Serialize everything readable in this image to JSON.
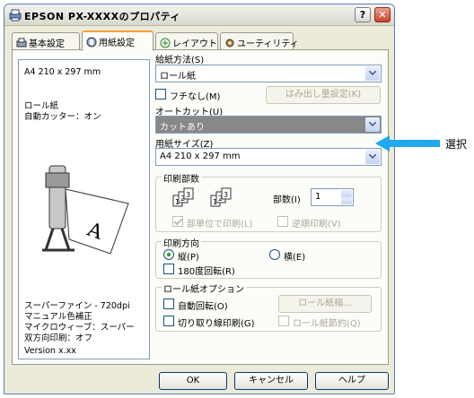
{
  "window": {
    "title": "EPSON PX-XXXXのプロパティ",
    "help_btn": "?",
    "close_btn": "✕"
  },
  "tabs": [
    "基本設定",
    "用紙設定",
    "レイアウト",
    "ユーティリティ"
  ],
  "preview": {
    "paper": "A4 210 x 297 mm",
    "source": "ロール紙",
    "autocut": "自動カッター：オン",
    "quality": "スーパーファイン - 720dpi",
    "color": "マニュアル色補正",
    "weave": "マイクロウィーブ：スーパー",
    "bidir": "双方向印刷：オフ",
    "version": "Version x.xx"
  },
  "paper_source": {
    "label": "給紙方法(S)",
    "value": "ロール紙"
  },
  "borderless": {
    "label": "フチなし(M)",
    "checked": false
  },
  "overflow_button": "はみ出し量設定(K)",
  "autocut": {
    "label": "オートカット(U)",
    "value": "カットあり"
  },
  "paper_size": {
    "label": "用紙サイズ(Z)",
    "value": "A4 210 x 297 mm"
  },
  "copies_group": {
    "title": "印刷部数",
    "copies_label": "部数(I)",
    "copies_value": "1",
    "collate_label": "部単位で印刷(L)",
    "reverse_label": "逆順印刷(V)"
  },
  "orientation_group": {
    "title": "印刷方向",
    "portrait_label": "縦(P)",
    "landscape_label": "横(E)",
    "rotate_label": "180度回転(R)",
    "selected": "portrait"
  },
  "roll_group": {
    "title": "ロール紙オプション",
    "autorotate_label": "自動回転(O)",
    "width_button": "ロール紙幅...",
    "cutline_label": "切り取り線印刷(G)",
    "save_label": "ロール紙節約(Q)"
  },
  "footer": {
    "ok": "OK",
    "cancel": "キャンセル",
    "help": "ヘルプ"
  },
  "annotation": {
    "callout": "選択"
  },
  "colors": {
    "accent_tab": "#f5a03a",
    "selected_combo": "#888888",
    "pointer": "#1fa8ef"
  }
}
